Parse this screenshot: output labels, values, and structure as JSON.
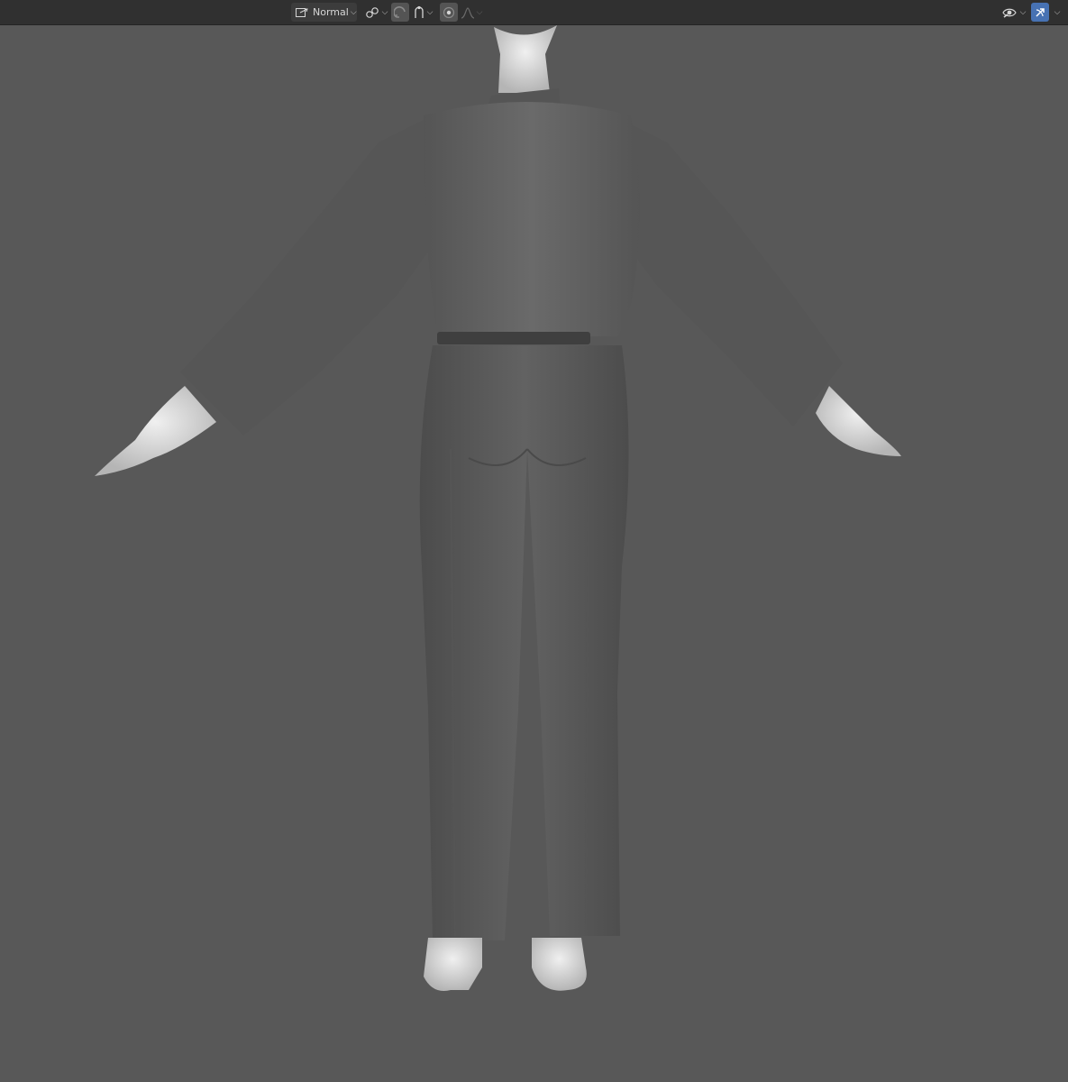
{
  "header": {
    "transform_orientation_label": "Normal",
    "icons": {
      "orientation": "transform-orientation-icon",
      "pivot": "pivot-point-icon",
      "snap": "snap-icon",
      "snap_target": "snap-target-icon",
      "proportional": "proportional-editing-icon",
      "falloff": "falloff-curve-icon",
      "visibility": "viewport-visibility-icon",
      "gizmo": "gizmo-toggle-icon"
    }
  },
  "colors": {
    "header_bg": "#303030",
    "viewport_bg": "#585858",
    "active_button": "#4772b3"
  }
}
